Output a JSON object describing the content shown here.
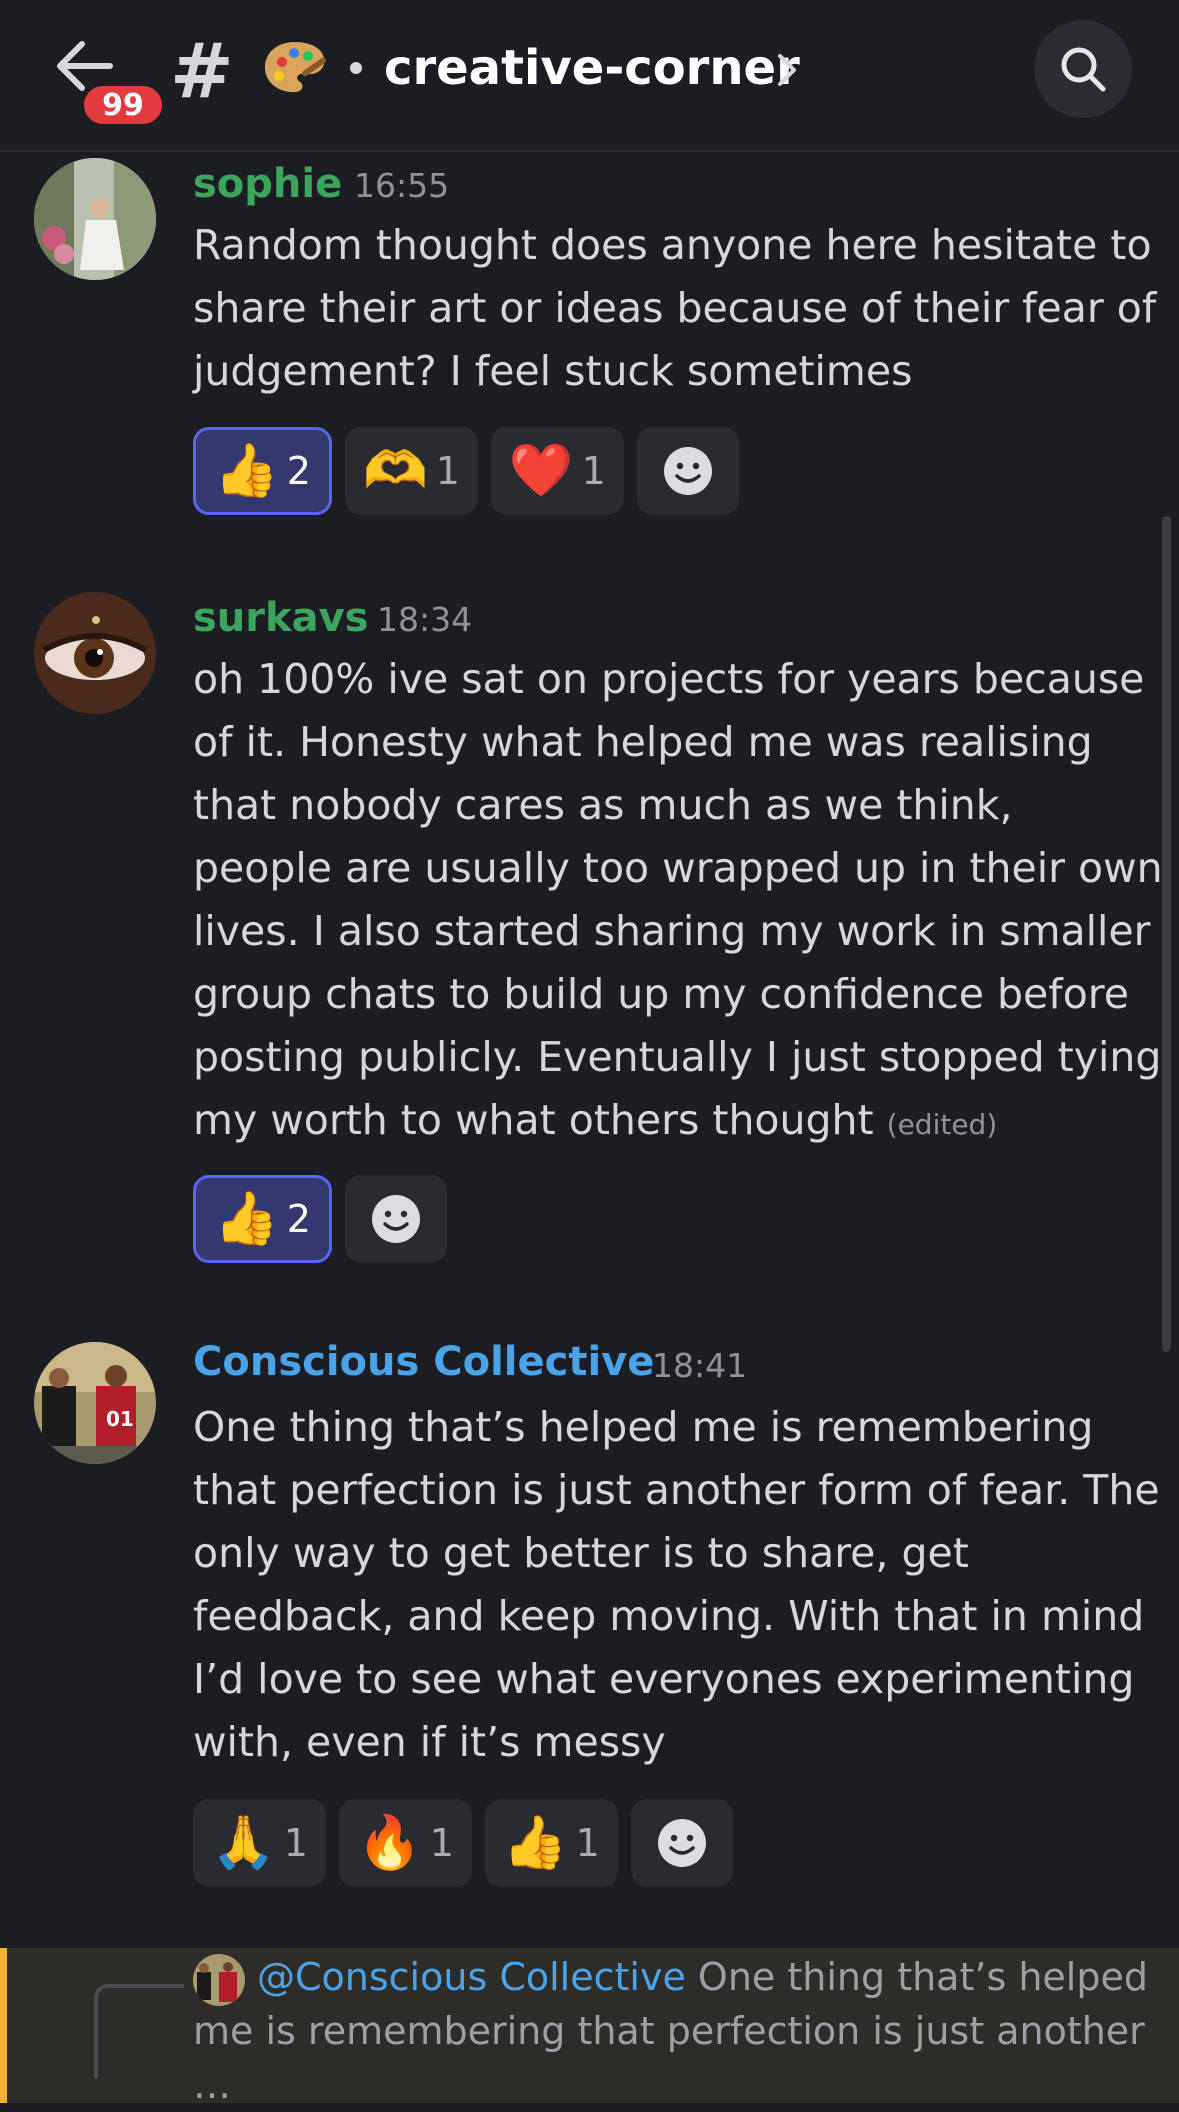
{
  "header": {
    "unread_badge": "99",
    "hash_symbol": "#",
    "channel_emoji": "🎨",
    "channel_name": "creative-corner"
  },
  "colors": {
    "background": "#1c1d22",
    "green_name": "#3ba55d",
    "blue_name": "#4aa3e8",
    "blurple": "#5865f2",
    "badge_red": "#e23a3f",
    "reply_accent": "#f0b232"
  },
  "messages": [
    {
      "author": "sophie",
      "time": "16:55",
      "body": "Random thought does anyone here hesitate to share their art or ideas because of their fear of judgement? I feel stuck sometimes",
      "edited": "",
      "reactions": [
        {
          "emoji": "👍",
          "count": "2",
          "me": true
        },
        {
          "emoji": "🫶",
          "count": "1",
          "me": false
        },
        {
          "emoji": "❤️",
          "count": "1",
          "me": false
        }
      ]
    },
    {
      "author": "surkavs",
      "time": "18:34",
      "body": "oh 100% ive sat on projects for years because of it.  Honesty what helped me was realising that nobody cares as much as we think, people are usually too wrapped up in their own lives. I also started sharing my work in smaller group chats to build up my confidence before posting publicly. Eventually I just stopped tying my worth to what others thought",
      "edited": "(edited)",
      "reactions": [
        {
          "emoji": "👍",
          "count": "2",
          "me": true
        }
      ]
    },
    {
      "author": "Conscious Collective",
      "time": "18:41",
      "body": "One thing that’s helped me is remembering that perfection is just another form of fear. The only way to get better is to share, get feedback, and keep moving. With that in mind I’d love to see what everyones experimenting with, even if it’s messy",
      "edited": "",
      "reactions": [
        {
          "emoji": "🙏",
          "count": "1",
          "me": false
        },
        {
          "emoji": "🔥",
          "count": "1",
          "me": false
        },
        {
          "emoji": "👍",
          "count": "1",
          "me": false
        }
      ]
    }
  ],
  "reply": {
    "mention": "@Conscious Collective",
    "preview": "One thing that’s helped me is remembering that perfection is just another …"
  }
}
